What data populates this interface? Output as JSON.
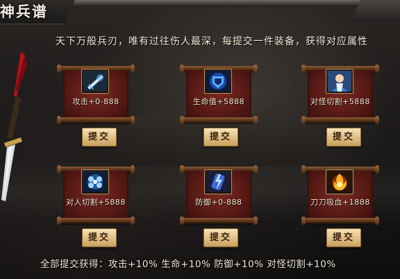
{
  "header": {
    "title": "神兵谱"
  },
  "intro": "天下万般兵刃，唯有过往伤人最深，每提交一件装备，获得对应属性",
  "items": [
    {
      "attr": "攻击+0-888",
      "icon": "frost-blade-icon",
      "button": "提交"
    },
    {
      "attr": "生命值+5888",
      "icon": "blue-shield-icon",
      "button": "提交"
    },
    {
      "attr": "对怪切割+5888",
      "icon": "warrior-portrait-icon",
      "button": "提交"
    },
    {
      "attr": "对人切割+5888",
      "icon": "ice-orb-icon",
      "button": "提交"
    },
    {
      "attr": "防御+0-888",
      "icon": "lightning-bracer-icon",
      "button": "提交"
    },
    {
      "attr": "刀刀吸血+1888",
      "icon": "flame-gem-icon",
      "button": "提交"
    }
  ],
  "footer": {
    "reward": "全部提交获得：攻击+10%  生命+10%  防御+10%  对怪切割+10%"
  },
  "colors": {
    "scroll_red": "#5a1b16",
    "button_gold": "#e4c48c",
    "text": "#f3e8d2"
  }
}
